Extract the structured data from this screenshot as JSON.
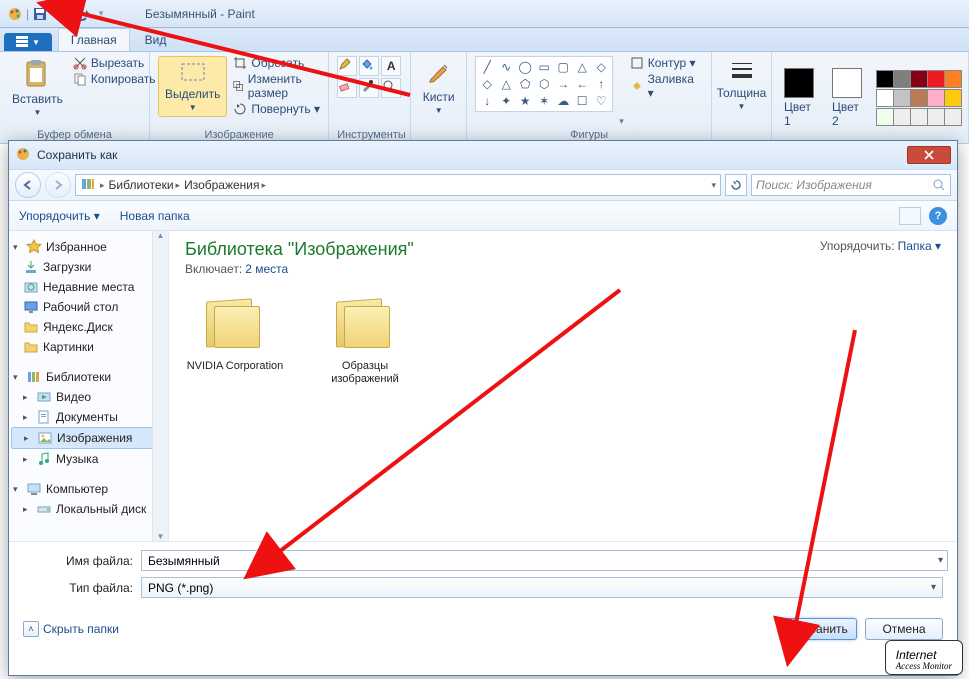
{
  "paint": {
    "title": "Безымянный - Paint",
    "tabs": {
      "file": "",
      "home": "Главная",
      "view": "Вид"
    },
    "clipboard": {
      "paste": "Вставить",
      "cut": "Вырезать",
      "copy": "Копировать",
      "group": "Буфер обмена"
    },
    "image": {
      "select": "Выделить",
      "crop": "Обрезать",
      "resize": "Изменить размер",
      "rotate": "Повернуть ▾",
      "group": "Изображение"
    },
    "tools": {
      "group": "Инструменты"
    },
    "brushes": {
      "label": "Кисти",
      "group": ""
    },
    "shapes": {
      "outline": "Контур ▾",
      "fill": "Заливка ▾",
      "group": "Фигуры"
    },
    "size": {
      "label": "Толщина",
      "group": ""
    },
    "colors": {
      "color1": "Цвет 1",
      "color2": "Цвет 2",
      "group": ""
    }
  },
  "dialog": {
    "title": "Сохранить как",
    "breadcrumb": {
      "root": "Библиотеки",
      "sub": "Изображения"
    },
    "search_placeholder": "Поиск: Изображения",
    "toolbar": {
      "organize": "Упорядочить ▾",
      "newfolder": "Новая папка"
    },
    "sidebar": {
      "favorites": "Избранное",
      "downloads": "Загрузки",
      "recent": "Недавние места",
      "desktop": "Рабочий стол",
      "yadisk": "Яндекс.Диск",
      "pictures_fav": "Картинки",
      "libraries": "Библиотеки",
      "video": "Видео",
      "documents": "Документы",
      "images": "Изображения",
      "music": "Музыка",
      "computer": "Компьютер",
      "localdisk": "Локальный диск"
    },
    "content": {
      "title": "Библиотека \"Изображения\"",
      "includes_label": "Включает:",
      "includes_link": "2 места",
      "arrange_label": "Упорядочить:",
      "arrange_value": "Папка ▾",
      "folders": [
        "NVIDIA Corporation",
        "Образцы изображений"
      ]
    },
    "fields": {
      "filename_label": "Имя файла:",
      "filename_value": "Безымянный",
      "filetype_label": "Тип файла:",
      "filetype_value": "PNG (*.png)"
    },
    "footer": {
      "hide": "Скрыть папки",
      "save": "Сохранить",
      "cancel": "Отмена"
    }
  },
  "watermark": {
    "line1": "Internet",
    "line2": "Access Monitor"
  }
}
